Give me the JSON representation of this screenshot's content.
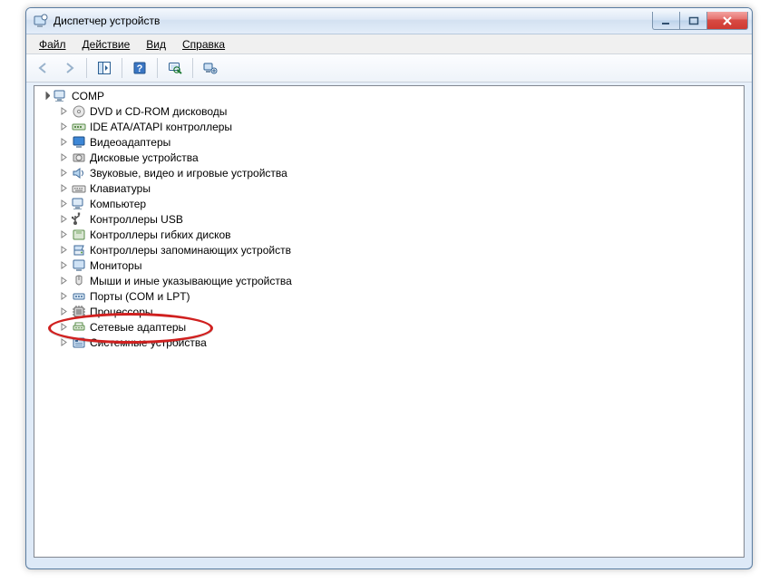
{
  "window": {
    "title": "Диспетчер устройств"
  },
  "menus": {
    "file": "Файл",
    "action": "Действие",
    "view": "Вид",
    "help": "Справка"
  },
  "tree": {
    "root": "COMP",
    "items": [
      {
        "label": "DVD и CD-ROM дисководы",
        "icon": "disc"
      },
      {
        "label": "IDE ATA/ATAPI контроллеры",
        "icon": "ide"
      },
      {
        "label": "Видеоадаптеры",
        "icon": "display"
      },
      {
        "label": "Дисковые устройства",
        "icon": "hdd"
      },
      {
        "label": "Звуковые, видео и игровые устройства",
        "icon": "sound"
      },
      {
        "label": "Клавиатуры",
        "icon": "keyboard"
      },
      {
        "label": "Компьютер",
        "icon": "computer"
      },
      {
        "label": "Контроллеры USB",
        "icon": "usb"
      },
      {
        "label": "Контроллеры гибких дисков",
        "icon": "floppyctl"
      },
      {
        "label": "Контроллеры запоминающих устройств",
        "icon": "storage"
      },
      {
        "label": "Мониторы",
        "icon": "monitor"
      },
      {
        "label": "Мыши и иные указывающие устройства",
        "icon": "mouse"
      },
      {
        "label": "Порты (COM и LPT)",
        "icon": "ports"
      },
      {
        "label": "Процессоры",
        "icon": "cpu"
      },
      {
        "label": "Сетевые адаптеры",
        "icon": "network",
        "highlighted": true
      },
      {
        "label": "Системные устройства",
        "icon": "system"
      }
    ]
  }
}
